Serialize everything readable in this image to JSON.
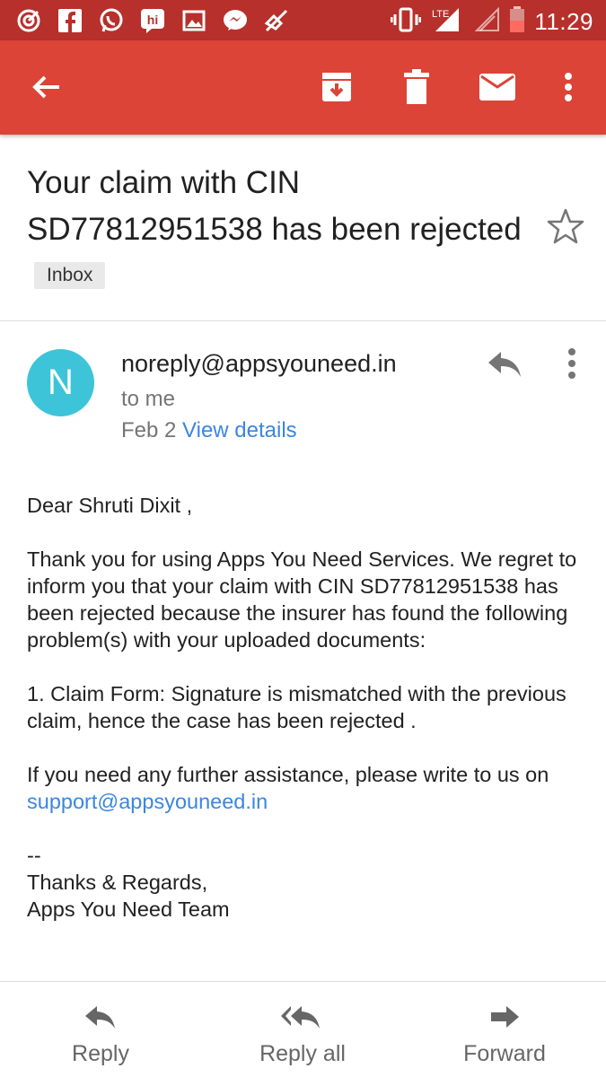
{
  "status_bar": {
    "time": "11:29",
    "network": "LTE",
    "icons": [
      "app-target-icon",
      "facebook-icon",
      "whatsapp-icon",
      "hike-icon",
      "image-icon",
      "messenger-icon",
      "mute-icon",
      "vibrate-icon",
      "signal-icon",
      "battery-icon"
    ]
  },
  "toolbar": {
    "actions": [
      "back-arrow-icon",
      "archive-icon",
      "delete-icon",
      "mark-unread-icon",
      "more-options-icon"
    ]
  },
  "email": {
    "subject": "Your claim with CIN SD77812951538 has been rejected",
    "label": "Inbox",
    "sender_initial": "N",
    "sender": "noreply@appsyouneed.in",
    "to": "to me",
    "date": "Feb 2",
    "view_details": "View details",
    "body": {
      "greeting": "Dear Shruti Dixit ,",
      "para1": "Thank you for using Apps You Need Services. We regret to inform you that your claim with CIN SD77812951538 has been rejected because the insurer has found the following problem(s) with your uploaded documents:",
      "para2": "1. Claim Form: Signature is mismatched with the previous claim, hence the case has been rejected .",
      "para3_prefix": "If you need any further assistance, please write to us on ",
      "support_email": "support@appsyouneed.in",
      "sig_dash": "--",
      "sig_line1": "Thanks & Regards,",
      "sig_line2": "Apps You Need Team"
    }
  },
  "actions": {
    "reply": "Reply",
    "reply_all": "Reply all",
    "forward": "Forward"
  },
  "colors": {
    "status_bar": "#b7302b",
    "app_bar": "#db4437",
    "avatar": "#3dc4d8",
    "link": "#3a86e0"
  }
}
